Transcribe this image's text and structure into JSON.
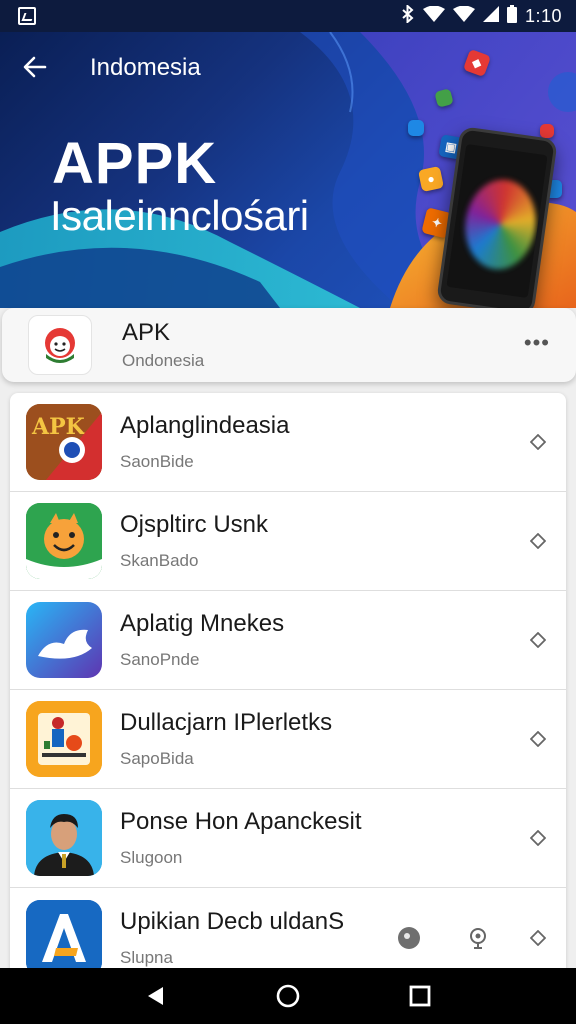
{
  "status_bar": {
    "notification_icon": "notification-box-icon",
    "icons": [
      "bluetooth-icon",
      "wifi-icon",
      "signal-icon",
      "signal-icon",
      "battery-icon"
    ],
    "time": "1:10"
  },
  "header": {
    "back_icon": "arrow-left-icon",
    "title": "Indomesia",
    "headline": "APPK",
    "subheadline": "Isaleinnclośari"
  },
  "featured": {
    "title": "APK",
    "subtitle": "Ondonesia",
    "more_icon": "more-horizontal-icon"
  },
  "apps": [
    {
      "title": "Aplanglindeasia",
      "subtitle": "SaonBide",
      "icon": "apk-logo-icon"
    },
    {
      "title": "Ojspltirc Usnk",
      "subtitle": "SkanBado",
      "icon": "smiley-character-icon"
    },
    {
      "title": "Aplatig Mnekes",
      "subtitle": "SanoPnde",
      "icon": "cloud-wave-icon"
    },
    {
      "title": "Dullacjarn IPlerletks",
      "subtitle": "SapoBida",
      "icon": "toys-collage-icon"
    },
    {
      "title": "Ponse Hon Apanckesit",
      "subtitle": "Slugoon",
      "icon": "man-portrait-icon"
    },
    {
      "title": "Upikian Decb uldanS",
      "subtitle": "Slupna",
      "icon": "letter-a-logo-icon"
    }
  ],
  "nav": {
    "back_icon": "triangle-back-icon",
    "home_icon": "circle-home-icon",
    "recents_icon": "square-recents-icon"
  },
  "colors": {
    "hero_blue": "#15327e",
    "hero_accent_orange": "#f28c1e",
    "status_bar": "#0d1b3e",
    "nav_bar": "#000000"
  }
}
